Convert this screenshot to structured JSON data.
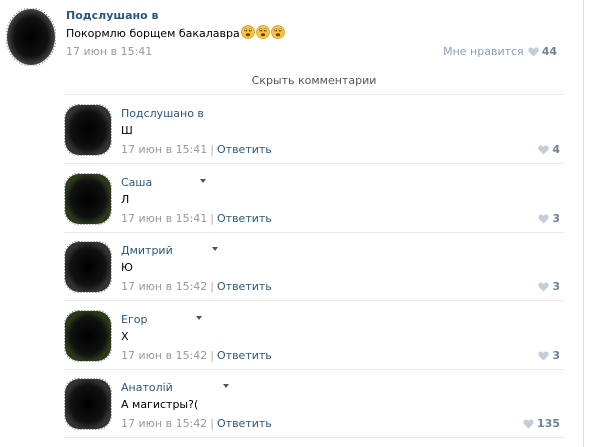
{
  "post": {
    "author": "Подслушано в",
    "text": "Покормлю борщем бакалавра",
    "emoji": [
      "smiley-emoji",
      "smiley-emoji",
      "smiley-emoji"
    ],
    "date": "17 июн в 15:41",
    "likes_label": "Мне нравится",
    "likes": "44"
  },
  "hide_comments": "Скрыть комментарии",
  "reply_label": "Ответить",
  "separator": "|",
  "colors": {
    "link": "#2b587a",
    "meta": "#999999",
    "like": "#6e8298",
    "heart": "#c3cedb"
  },
  "comments": [
    {
      "author": "Подслушано в",
      "text": "Ш",
      "date": "17 июн в 15:41",
      "likes": "4",
      "has_caret": false
    },
    {
      "author": "Саша",
      "text": "Л",
      "date": "17 июн в 15:41",
      "likes": "3",
      "has_caret": true
    },
    {
      "author": "Дмитрий",
      "text": "Ю",
      "date": "17 июн в 15:42",
      "likes": "3",
      "has_caret": true
    },
    {
      "author": "Егор",
      "text": "Х",
      "date": "17 июн в 15:42",
      "likes": "3",
      "has_caret": true
    },
    {
      "author": "Анатолій",
      "text": "А магистры?(",
      "date": "17 июн в 15:42",
      "likes": "135",
      "has_caret": true
    }
  ]
}
